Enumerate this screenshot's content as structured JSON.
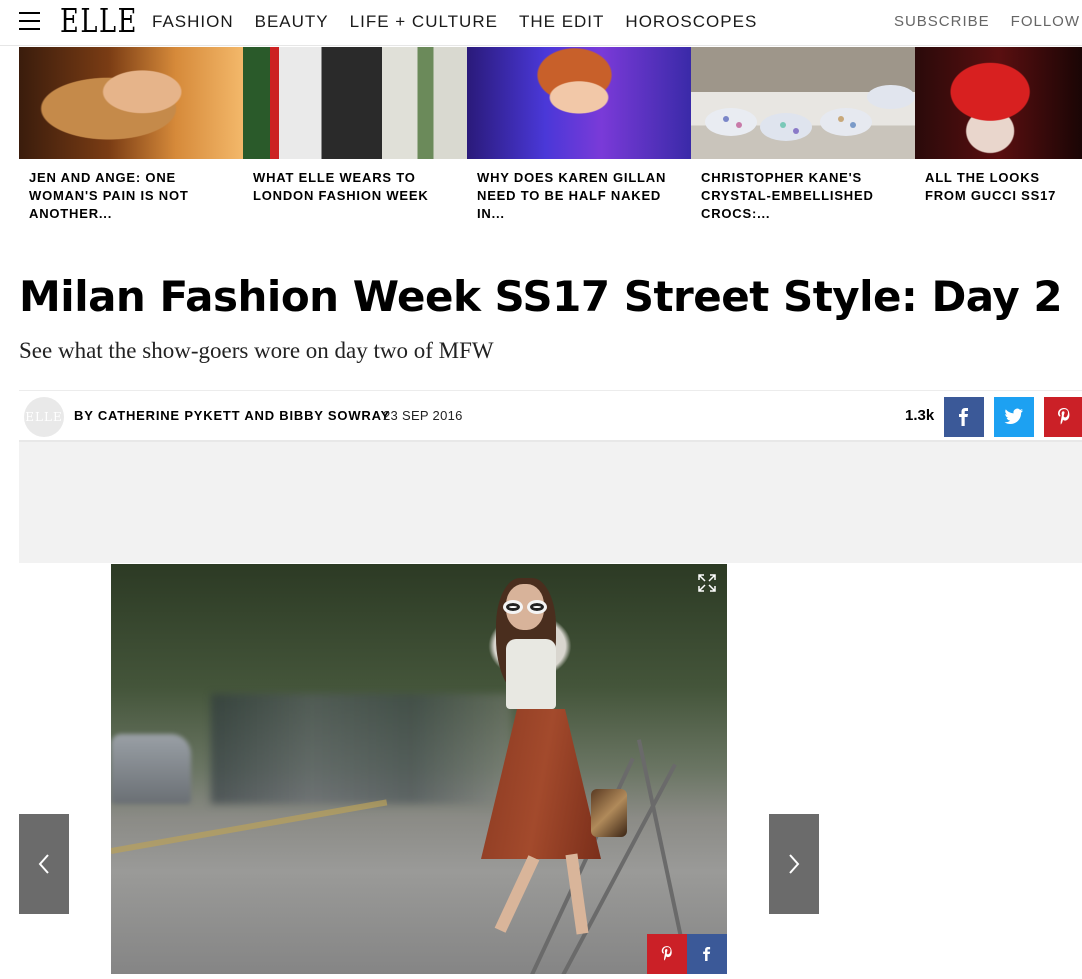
{
  "header": {
    "logo": "ELLE",
    "nav": [
      "FASHION",
      "BEAUTY",
      "LIFE + CULTURE",
      "THE EDIT",
      "HOROSCOPES"
    ],
    "subscribe": "SUBSCRIBE",
    "follow": "FOLLOW"
  },
  "related": [
    {
      "title": "JEN AND ANGE: ONE WOMAN'S PAIN IS NOT ANOTHER..."
    },
    {
      "title": "WHAT ELLE WEARS TO LONDON FASHION WEEK"
    },
    {
      "title": "WHY DOES KAREN GILLAN NEED TO BE HALF NAKED IN..."
    },
    {
      "title": "CHRISTOPHER KANE'S CRYSTAL-EMBELLISHED CROCS:..."
    },
    {
      "title": "ALL THE LOOKS FROM GUCCI SS17"
    }
  ],
  "article": {
    "headline": "Milan Fashion Week SS17 Street Style: Day 2",
    "subhead": "See what the show-goers wore on day two of MFW",
    "avatar_text": "ELLE",
    "byline": "BY CATHERINE PYKETT AND BIBBY SOWRAY",
    "date": "23 SEP 2016",
    "share_count": "1.3k"
  },
  "colors": {
    "facebook": "#3b5998",
    "twitter": "#1da1f2",
    "pinterest": "#cb2027",
    "slider_arrow": "#6b6b6b"
  },
  "icons": {
    "menu": "hamburger-icon",
    "facebook": "facebook-icon",
    "twitter": "twitter-icon",
    "pinterest": "pinterest-icon",
    "expand": "expand-icon",
    "prev": "chevron-left-icon",
    "next": "chevron-right-icon"
  }
}
